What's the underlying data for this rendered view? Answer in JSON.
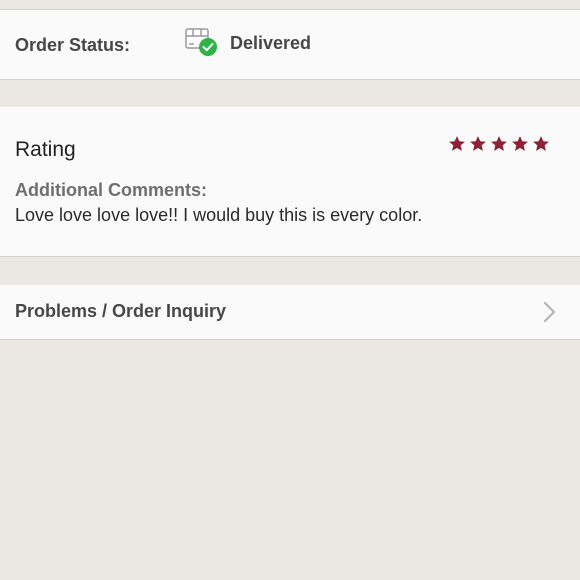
{
  "order_status": {
    "label": "Order Status:",
    "value": "Delivered",
    "icon": "package-delivered-icon"
  },
  "rating": {
    "title": "Rating",
    "stars": 5,
    "max_stars": 5,
    "star_color": "#8b2236"
  },
  "comments": {
    "label": "Additional Comments:",
    "text": "Love love love love!! I would buy this is every color."
  },
  "inquiry": {
    "label": "Problems / Order Inquiry",
    "icon": "chevron-right-icon"
  },
  "colors": {
    "background": "#ebe8e3",
    "card": "#fbfafb",
    "check_green": "#2fb24a"
  }
}
